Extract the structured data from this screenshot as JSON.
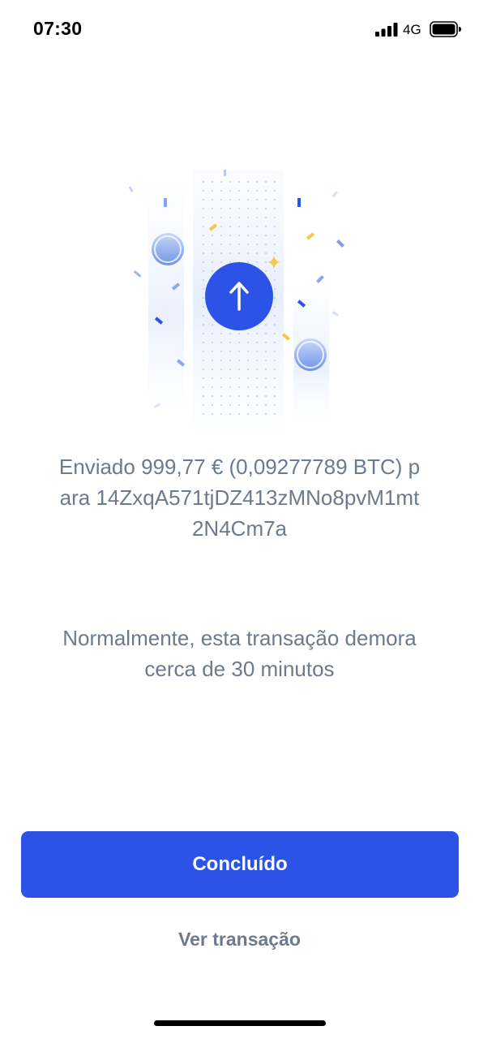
{
  "status_bar": {
    "time": "07:30",
    "network": "4G",
    "icons": [
      "signal-icon",
      "battery-icon"
    ]
  },
  "illustration": {
    "icon": "arrow-up-icon",
    "accent_color": "#2c53e6",
    "confetti_colors": [
      "#2c53e6",
      "#8fb0f0",
      "#f2c94c"
    ]
  },
  "message": {
    "sent": "Enviado 999,77 € (0,09277789 BTC) para 14ZxqA571tjDZ413zMNo8pvM1mt2N4Cm7a",
    "info": "Normalmente, esta transação demora cerca de 30 minutos"
  },
  "actions": {
    "done_label": "Concluído",
    "view_transaction_label": "Ver transação"
  },
  "colors": {
    "primary": "#2c53e6",
    "text_secondary": "#6b7a8d"
  }
}
